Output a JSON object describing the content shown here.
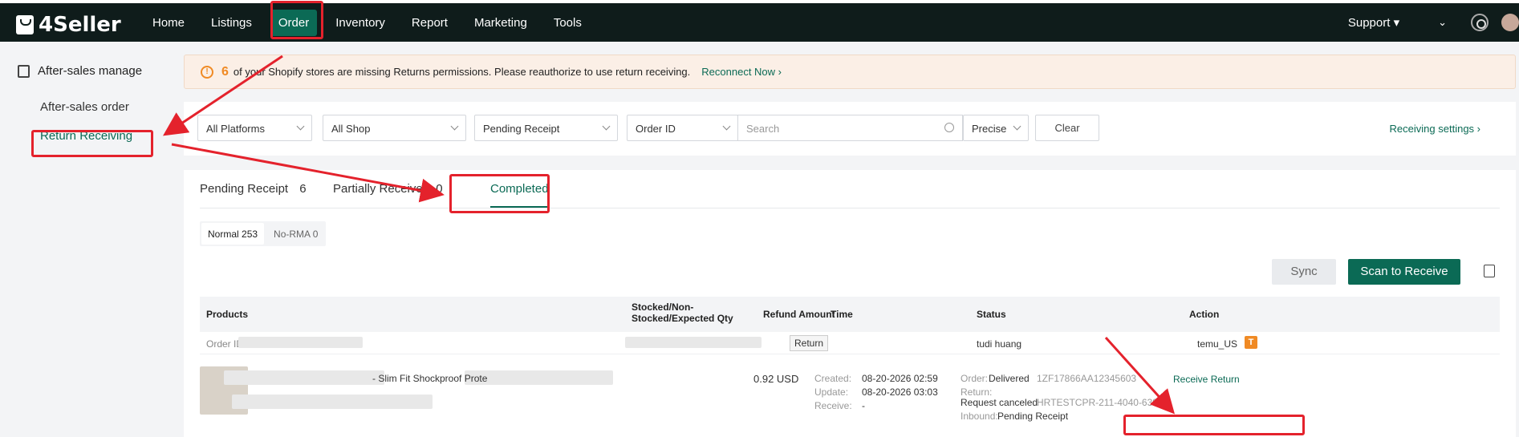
{
  "app": {
    "name": "4Seller"
  },
  "nav": {
    "items": [
      "Home",
      "Listings",
      "Order",
      "Inventory",
      "Report",
      "Marketing",
      "Tools"
    ],
    "active": "Order",
    "support": "Support ▾",
    "chevron": "⌄"
  },
  "sidebar": {
    "header": "After-sales manage",
    "items": [
      "After-sales order",
      "Return Receiving"
    ],
    "active": "Return Receiving"
  },
  "banner": {
    "count": "6",
    "message": "of your Shopify stores are missing Returns permissions. Please reauthorize to use return receiving.",
    "link": "Reconnect Now ›"
  },
  "filters": {
    "platform": "All Platforms",
    "shop": "All Shop",
    "status": "Pending Receipt",
    "search_field": "Order ID",
    "search_placeholder": "Search",
    "match": "Precise",
    "clear": "Clear",
    "settings_link": "Receiving settings ›"
  },
  "tabs": [
    {
      "label": "Pending Receipt",
      "count": "6"
    },
    {
      "label": "Partially Received",
      "count": "0"
    },
    {
      "label": "Completed",
      "count": ""
    }
  ],
  "active_tab": "Completed",
  "segments": [
    {
      "label": "Normal",
      "count": "253"
    },
    {
      "label": "No-RMA",
      "count": "0"
    }
  ],
  "actions": {
    "sync": "Sync",
    "scan": "Scan to Receive"
  },
  "table": {
    "headers": {
      "products": "Products",
      "qty": "Stocked/Non-Stocked/Expected Qty",
      "refund": "Refund Amount",
      "time": "Time",
      "status": "Status",
      "action": "Action"
    },
    "row": {
      "order_id_label": "Order ID",
      "return_tag": "Return",
      "user": "tudi huang",
      "store": "temu_US",
      "store_icon": "T",
      "product_title": "- Slim Fit Shockproof Prote",
      "refund": "0.92 USD",
      "created_label": "Created:",
      "created": "08-20-2026 02:59",
      "update_label": "Update:",
      "update": "08-20-2026 03:03",
      "receive_label": "Receive:",
      "receive": "-",
      "order_label": "Order:",
      "order_status": "Delivered",
      "tracking": "1ZF17866AA12345603",
      "return_label": "Return:",
      "return_status": "Request canceled",
      "return_id": "HRTESTCPR-211-4040-638...",
      "inbound_label": "Inbound:",
      "inbound_status": "Pending Receipt",
      "action": "Receive Return"
    }
  },
  "colors": {
    "brand": "#0b6a55",
    "topbar": "#0f1c1b",
    "annotation": "#e4222c",
    "warning": "#f08a24"
  }
}
